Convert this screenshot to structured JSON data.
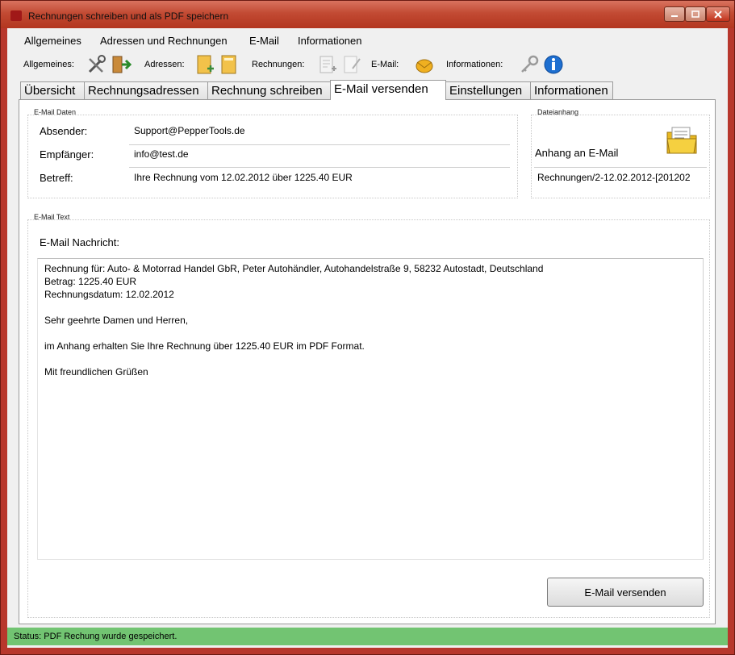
{
  "window": {
    "title": "Rechnungen schreiben und als PDF speichern"
  },
  "menu": [
    "Allgemeines",
    "Adressen und Rechnungen",
    "E-Mail",
    "Informationen"
  ],
  "toolbar": {
    "allgemeines_label": "Allgemeines:",
    "adressen_label": "Adressen:",
    "rechnungen_label": "Rechnungen:",
    "email_label": "E-Mail:",
    "informationen_label": "Informationen:"
  },
  "tabs": [
    "Übersicht",
    "Rechnungsadressen",
    "Rechnung schreiben",
    "E-Mail versenden",
    "Einstellungen",
    "Informationen"
  ],
  "active_tab": "E-Mail versenden",
  "email_daten": {
    "group_label": "E-Mail Daten",
    "absender_label": "Absender:",
    "absender_value": "Support@PepperTools.de",
    "empfaenger_label": "Empfänger:",
    "empfaenger_value": "info@test.de",
    "betreff_label": "Betreff:",
    "betreff_value": "Ihre Rechnung vom 12.02.2012 über 1225.40 EUR"
  },
  "dateianhang": {
    "group_label": "Dateianhang",
    "anhang_label": "Anhang an E-Mail",
    "anhang_value": "Rechnungen/2-12.02.2012-[201202"
  },
  "email_text": {
    "group_label": "E-Mail Text",
    "nachricht_label": "E-Mail Nachricht:",
    "body": "Rechnung für: Auto- & Motorrad Handel GbR, Peter Autohändler, Autohandelstraße 9, 58232 Autostadt, Deutschland\nBetrag: 1225.40 EUR\nRechnungsdatum: 12.02.2012\n\nSehr geehrte Damen und Herren,\n\nim Anhang erhalten Sie Ihre Rechnung über 1225.40 EUR im PDF Format.\n\nMit freundlichen Grüßen"
  },
  "send_button_label": "E-Mail versenden",
  "status": "Status:  PDF Rechung wurde gespeichert.",
  "colors": {
    "titlebar": "#c24a33",
    "statusbar": "#72c472"
  }
}
